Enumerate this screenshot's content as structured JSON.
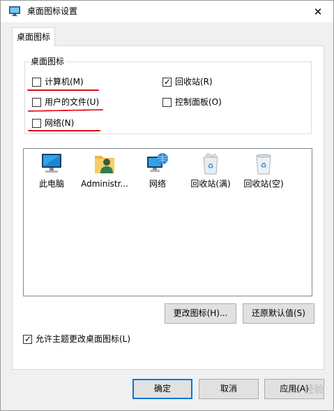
{
  "window": {
    "title": "桌面图标设置",
    "close_glyph": "✕"
  },
  "tabs": [
    {
      "label": "桌面图标",
      "selected": true
    }
  ],
  "group": {
    "legend": "桌面图标",
    "checkboxes": [
      {
        "label": "计算机(M)",
        "checked": false
      },
      {
        "label": "回收站(R)",
        "checked": true
      },
      {
        "label": "用户的文件(U)",
        "checked": false
      },
      {
        "label": "控制面板(O)",
        "checked": false
      },
      {
        "label": "网络(N)",
        "checked": false
      }
    ]
  },
  "icons": [
    {
      "label": "此电脑",
      "icon": "monitor-icon"
    },
    {
      "label": "Administr...",
      "icon": "user-folder-icon"
    },
    {
      "label": "网络",
      "icon": "network-globe-icon"
    },
    {
      "label": "回收站(满)",
      "icon": "recycle-bin-full-icon"
    },
    {
      "label": "回收站(空)",
      "icon": "recycle-bin-empty-icon"
    }
  ],
  "buttons": {
    "change_icon": "更改图标(H)...",
    "restore_default": "还原默认值(S)",
    "ok": "确定",
    "cancel": "取消",
    "apply": "应用(A)"
  },
  "allow_theme": {
    "label": "允许主题更改桌面图标(L)",
    "checked": true
  },
  "watermark": "Bai 经验",
  "colors": {
    "annotation_red": "#e0101a",
    "focus_blue": "#0078d7"
  }
}
